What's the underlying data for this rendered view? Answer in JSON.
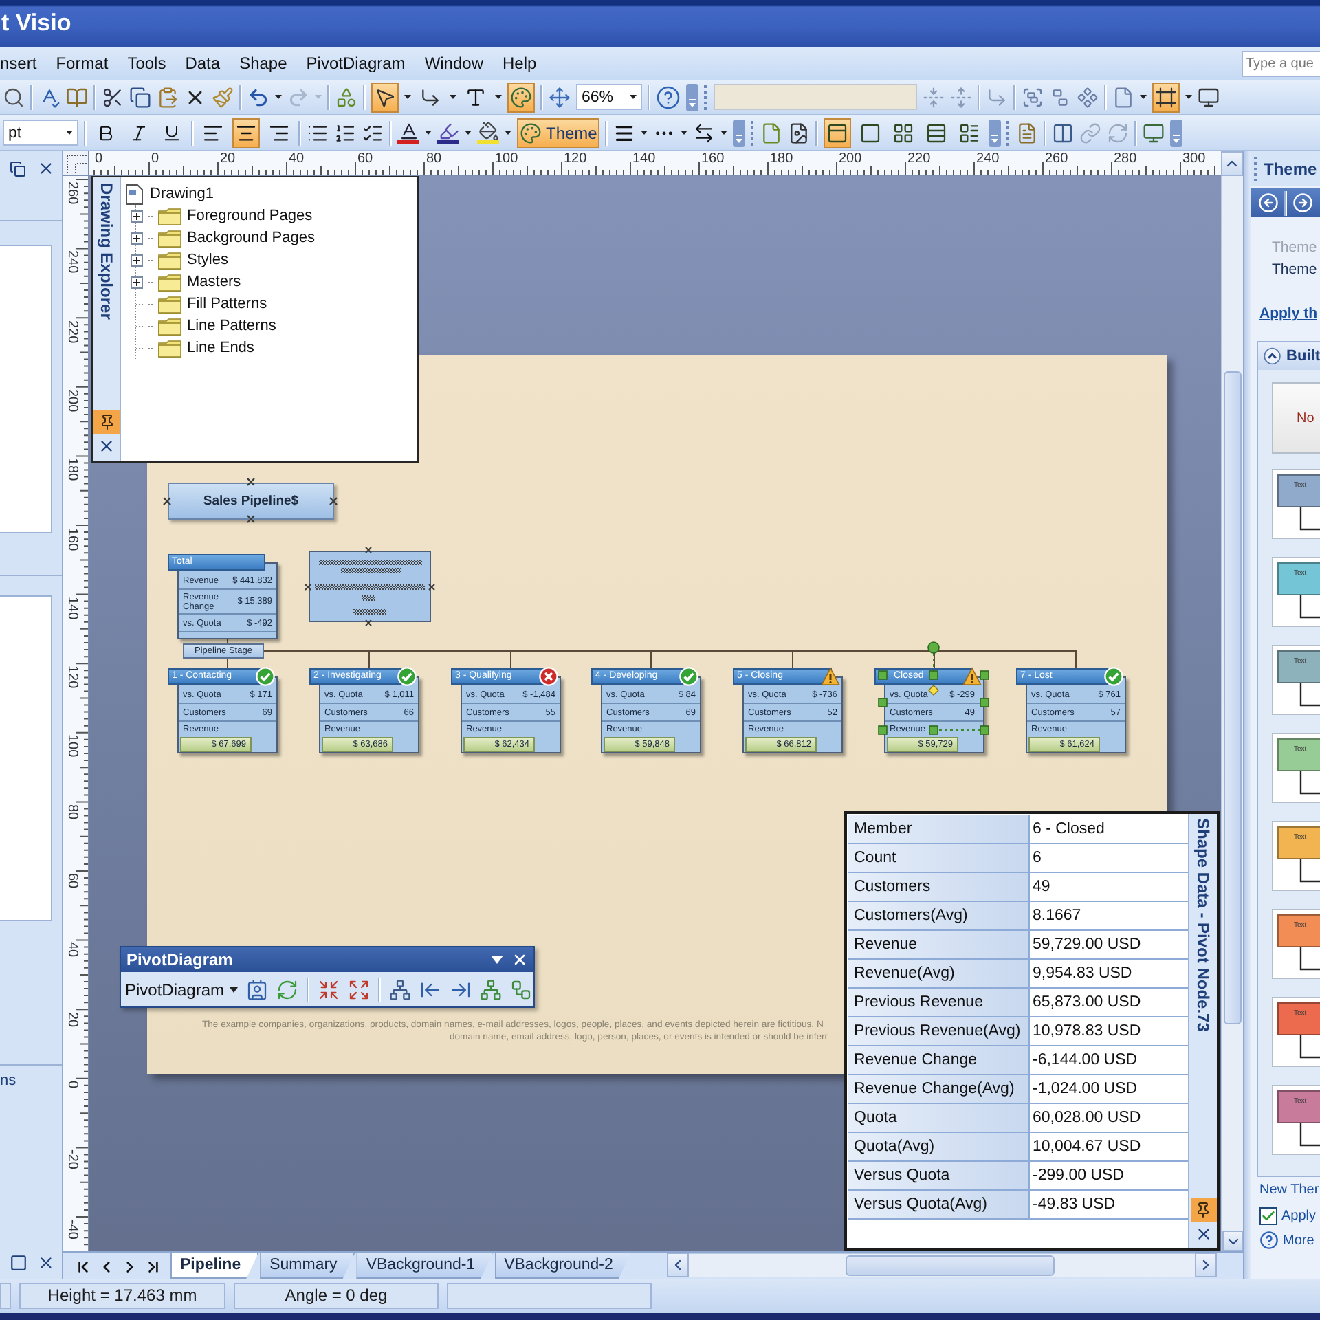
{
  "window": {
    "title": "t Visio"
  },
  "menu": [
    "nsert",
    "Format",
    "Tools",
    "Data",
    "Shape",
    "PivotDiagram",
    "Window",
    "Help"
  ],
  "help_search": {
    "placeholder": "Type a que"
  },
  "standard_toolbar": {
    "redo": {
      "disabled": true
    },
    "pointer_tool": {
      "on": true
    },
    "connector_tool": {
      "on": false
    },
    "text_tool": {
      "on": false
    },
    "theme_toggle": {
      "on": true
    },
    "zoom": "66%",
    "style_field": {
      "disabled": true
    },
    "layout_toggle": {
      "on": true
    }
  },
  "formatting_toolbar": {
    "font_size": "pt",
    "bold": {
      "on": false
    },
    "italic": {
      "on": false
    },
    "underline": {
      "on": false
    },
    "align": [
      {
        "selected": false
      },
      {
        "selected": true
      },
      {
        "selected": false
      }
    ],
    "theme_button": {
      "label": "Theme",
      "on": true
    },
    "layout_buttons": [
      {
        "selected": true
      },
      {
        "selected": false
      },
      {
        "selected": false
      },
      {
        "selected": false
      },
      {
        "selected": false
      }
    ]
  },
  "shapes_window": {
    "caption": "ns"
  },
  "horizontal_ruler": [
    "0",
    "0",
    "20",
    "40",
    "60",
    "80",
    "100",
    "120",
    "140",
    "160",
    "180",
    "200",
    "220",
    "240",
    "260",
    "280",
    "300"
  ],
  "vertical_ruler": [
    "260",
    "240",
    "220",
    "200",
    "180",
    "160",
    "140",
    "120",
    "100",
    "80",
    "60",
    "40",
    "20",
    "0",
    "-20",
    "-40"
  ],
  "drawing_explorer": {
    "title": "Drawing Explorer",
    "tree": {
      "label": "Drawing1",
      "children": [
        {
          "label": "Foreground Pages",
          "expanded": false
        },
        {
          "label": "Background Pages",
          "expanded": false
        },
        {
          "label": "Styles",
          "expanded": false
        },
        {
          "label": "Masters",
          "expanded": false
        },
        {
          "label": "Fill Patterns"
        },
        {
          "label": "Line Patterns"
        },
        {
          "label": "Line Ends"
        }
      ]
    }
  },
  "diagram": {
    "title": "Sales Pipeline$",
    "total": {
      "header": "Total",
      "rows": [
        {
          "label": "Revenue",
          "value": "$ 441,832"
        },
        {
          "label": "Revenue Change",
          "value": "$ 15,389"
        },
        {
          "label": "vs. Quota",
          "value": "$ -492"
        }
      ]
    },
    "breakdown": "Pipeline Stage",
    "nodes": [
      {
        "label": "1 - Contacting",
        "kind": "ok",
        "selected": false,
        "rows": [
          {
            "label": "vs. Quota",
            "value": "$ 171"
          },
          {
            "label": "Customers",
            "value": "69"
          },
          {
            "label": "Revenue",
            "value": "$ 67,699"
          }
        ]
      },
      {
        "label": "2 - Investigating",
        "kind": "ok",
        "selected": false,
        "rows": [
          {
            "label": "vs. Quota",
            "value": "$ 1,011"
          },
          {
            "label": "Customers",
            "value": "66"
          },
          {
            "label": "Revenue",
            "value": "$ 63,686"
          }
        ]
      },
      {
        "label": "3 - Qualifying",
        "kind": "error",
        "selected": false,
        "rows": [
          {
            "label": "vs. Quota",
            "value": "$ -1,484"
          },
          {
            "label": "Customers",
            "value": "55"
          },
          {
            "label": "Revenue",
            "value": "$ 62,434"
          }
        ]
      },
      {
        "label": "4 - Developing",
        "kind": "ok",
        "selected": false,
        "rows": [
          {
            "label": "vs. Quota",
            "value": "$ 84"
          },
          {
            "label": "Customers",
            "value": "69"
          },
          {
            "label": "Revenue",
            "value": "$ 59,848"
          }
        ]
      },
      {
        "label": "5 - Closing",
        "kind": "warning",
        "selected": false,
        "rows": [
          {
            "label": "vs. Quota",
            "value": "$ -736"
          },
          {
            "label": "Customers",
            "value": "52"
          },
          {
            "label": "Revenue",
            "value": "$ 66,812"
          }
        ]
      },
      {
        "label": "Closed",
        "kind": "warning",
        "selected": true,
        "rows": [
          {
            "label": "vs. Quota",
            "value": "$ -299"
          },
          {
            "label": "Customers",
            "value": "49"
          },
          {
            "label": "Revenue",
            "value": "$ 59,729"
          }
        ]
      },
      {
        "label": "7 - Lost",
        "kind": "ok",
        "selected": false,
        "rows": [
          {
            "label": "vs. Quota",
            "value": "$ 761"
          },
          {
            "label": "Customers",
            "value": "57"
          },
          {
            "label": "Revenue",
            "value": "$ 61,624"
          }
        ]
      }
    ],
    "disclaimer": [
      "The example companies, organizations, products, domain names, e-mail addresses, logos, people, places, and events depicted herein are fictitious. N",
      "domain name, email address, logo, person, places, or events is intended or should be inferr"
    ]
  },
  "pivot_toolbar": {
    "title": "PivotDiagram",
    "menu": "PivotDiagram"
  },
  "shape_data": {
    "title": "Shape Data - Pivot Node.73",
    "rows": [
      {
        "label": "Member",
        "value": "6 - Closed"
      },
      {
        "label": "Count",
        "value": "6"
      },
      {
        "label": "Customers",
        "value": "49"
      },
      {
        "label": "Customers(Avg)",
        "value": "8.1667"
      },
      {
        "label": "Revenue",
        "value": "59,729.00 USD"
      },
      {
        "label": "Revenue(Avg)",
        "value": "9,954.83 USD"
      },
      {
        "label": "Previous Revenue",
        "value": "65,873.00 USD"
      },
      {
        "label": "Previous Revenue(Avg)",
        "value": "10,978.83 USD"
      },
      {
        "label": "Revenue Change",
        "value": "-6,144.00 USD"
      },
      {
        "label": "Revenue Change(Avg)",
        "value": "-1,024.00 USD"
      },
      {
        "label": "Quota",
        "value": "60,028.00 USD"
      },
      {
        "label": "Quota(Avg)",
        "value": "10,004.67 USD"
      },
      {
        "label": "Versus Quota",
        "value": "-299.00 USD"
      },
      {
        "label": "Versus Quota(Avg)",
        "value": "-49.83 USD"
      }
    ]
  },
  "page_tabs": [
    {
      "label": "Pipeline",
      "selected": true
    },
    {
      "label": "Summary",
      "selected": false
    },
    {
      "label": "VBackground-1",
      "selected": false
    },
    {
      "label": "VBackground-2",
      "selected": false
    }
  ],
  "status_bar": [
    "Height = 17.463 mm",
    "Angle = 0 deg"
  ],
  "theme_pane": {
    "title": "Theme",
    "links": [
      {
        "label": "Theme",
        "disabled": true
      },
      {
        "label": "Theme",
        "disabled": false
      }
    ],
    "apply_link": "Apply th",
    "section": {
      "title": "Built",
      "expanded": true,
      "no_theme": "No",
      "themes": [
        {
          "label": "Text",
          "color": "#8faacb"
        },
        {
          "label": "Text",
          "color": "#74c6d6"
        },
        {
          "label": "Text",
          "color": "#8db2bc"
        },
        {
          "label": "Text",
          "color": "#98cc96"
        },
        {
          "label": "Text",
          "color": "#f2b450"
        },
        {
          "label": "Text",
          "color": "#f28e55"
        },
        {
          "label": "Text",
          "color": "#ec6b4f"
        },
        {
          "label": "Text",
          "color": "#c97b9c"
        }
      ]
    },
    "new_theme_link": "New Ther",
    "apply_checkbox": {
      "label": "Apply",
      "checked": true
    },
    "help_link": "More"
  }
}
